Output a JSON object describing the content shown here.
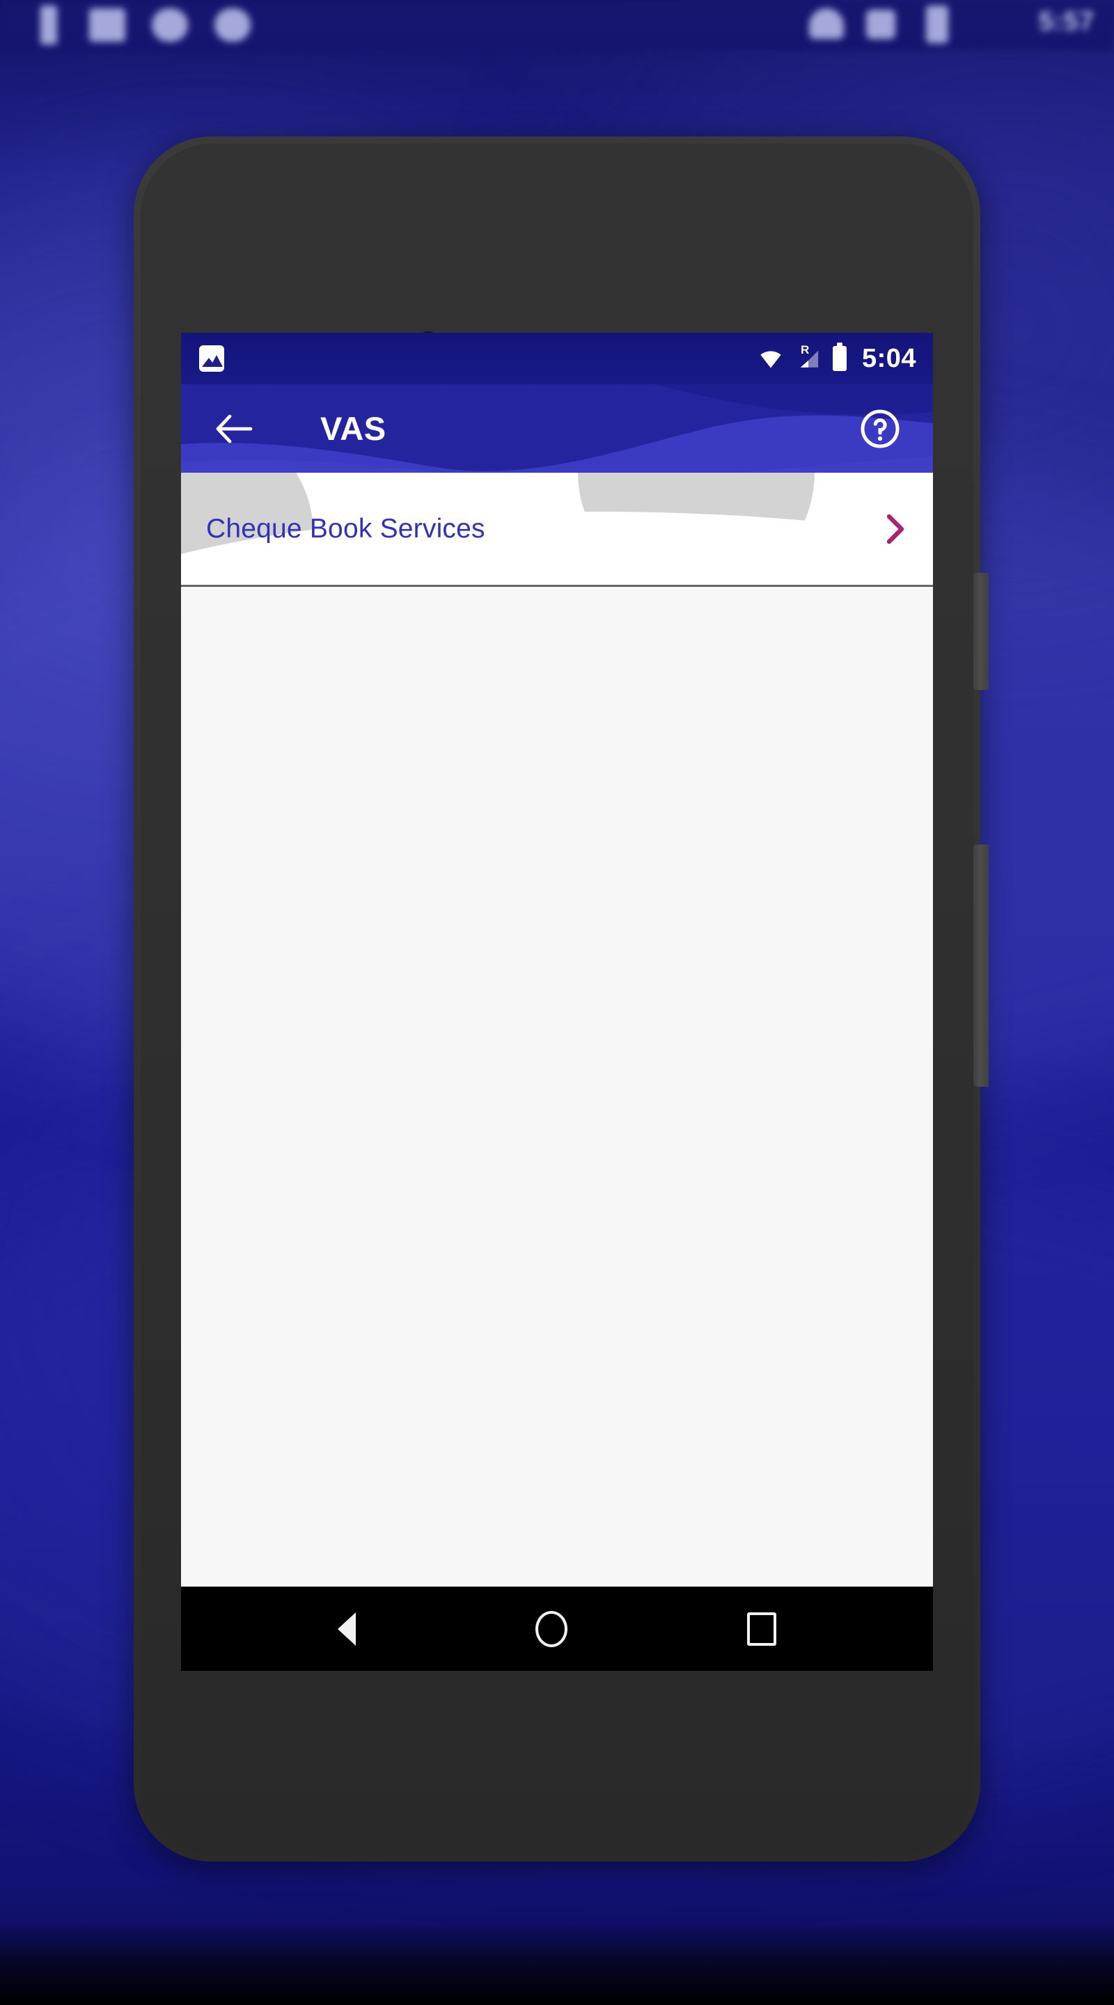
{
  "host": {
    "time": "5:57",
    "tray_icons": [
      "battery-icon",
      "cast-icon",
      "phone-icon"
    ],
    "taskbar_icons": [
      "window-icon",
      "app-icon-1",
      "app-icon-2",
      "app-icon-3"
    ]
  },
  "device": {
    "camera": "front-camera",
    "speaker": "earpiece-speaker",
    "sensor": "proximity-sensor",
    "buttons": [
      "power-button",
      "volume-button"
    ]
  },
  "status_bar": {
    "notification_icon": "photo-icon",
    "wifi_icon": "wifi-icon",
    "signal_icon": "signal-icon",
    "roaming_label": "R",
    "battery_icon": "battery-icon",
    "time": "5:04"
  },
  "app_bar": {
    "back_icon": "back-arrow-icon",
    "title": "VAS",
    "help_icon": "help-circle-icon"
  },
  "main": {
    "list_items": [
      {
        "label": "Cheque Book Services",
        "chevron_icon": "chevron-right-icon"
      }
    ]
  },
  "nav_bar": {
    "back": "back-triangle-icon",
    "home": "home-circle-icon",
    "recents": "recents-square-icon"
  },
  "colors": {
    "status_bar_bg": "#16167e",
    "app_bar_bg": "#24249e",
    "app_bar_wave_dark": "#1c1c8c",
    "app_bar_wave_light": "#3a3ac0",
    "accent_text": "#3232b4",
    "chevron": "#a8246e",
    "screen_bg": "#f7f7f8",
    "card_bg": "#ffffff",
    "deco_circle": "#d3d3d3",
    "divider": "#4c4c4c",
    "nav_bar_bg": "#000000",
    "wallpaper_blue": "#1d1d86"
  }
}
